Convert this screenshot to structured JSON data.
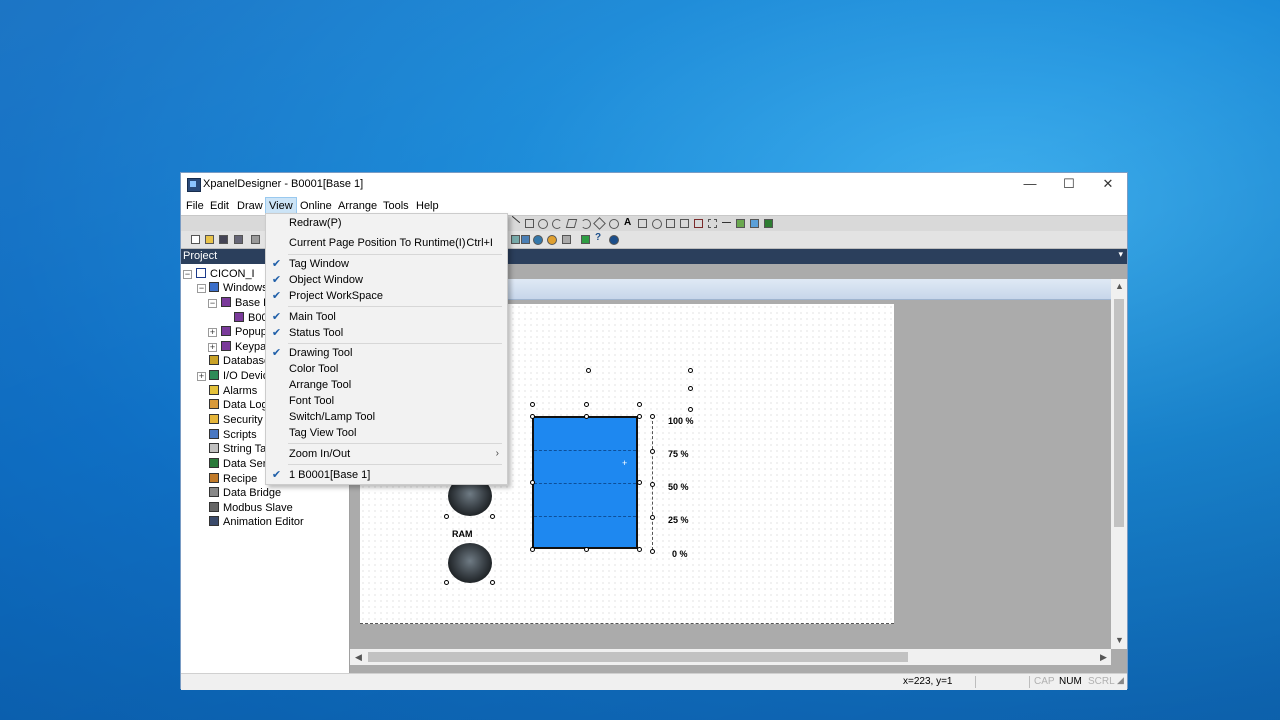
{
  "window": {
    "title": "XpanelDesigner - B0001[Base 1]",
    "minimize_glyph": "—",
    "maximize_glyph": "☐",
    "close_glyph": "✕"
  },
  "menubar": [
    "File",
    "Edit",
    "Draw",
    "View",
    "Online",
    "Arrange",
    "Tools",
    "Help"
  ],
  "project_panel": {
    "title": "Project",
    "tree": [
      {
        "label": "CICON_I",
        "icon": "project-icon"
      },
      {
        "label": "Windows",
        "icon": "monitor-icon"
      },
      {
        "label": "Base P",
        "icon": "window-icon"
      },
      {
        "label": "B00",
        "icon": "window-icon"
      },
      {
        "label": "Popup",
        "icon": "window-icon"
      },
      {
        "label": "Keypa",
        "icon": "window-icon"
      },
      {
        "label": "Database",
        "icon": "database-icon"
      },
      {
        "label": "I/O Devic",
        "icon": "io-device-icon"
      },
      {
        "label": "Alarms",
        "icon": "bell-icon"
      },
      {
        "label": "Data Log",
        "icon": "log-icon"
      },
      {
        "label": "Security",
        "icon": "key-icon"
      },
      {
        "label": "Scripts",
        "icon": "script-icon"
      },
      {
        "label": "String Tab",
        "icon": "string-table-icon"
      },
      {
        "label": "Data Serv",
        "icon": "data-server-icon"
      },
      {
        "label": "Recipe",
        "icon": "recipe-icon"
      },
      {
        "label": "Data Bridge",
        "icon": "bridge-icon"
      },
      {
        "label": "Modbus Slave",
        "icon": "modbus-icon"
      },
      {
        "label": "Animation Editor",
        "icon": "animation-icon"
      }
    ]
  },
  "view_menu": {
    "items": [
      {
        "label": "Redraw(P)",
        "checked": false
      },
      {
        "label": "Current Page Position To Runtime(I)",
        "shortcut": "Ctrl+I",
        "checked": false
      },
      {
        "label": "Tag Window",
        "checked": true
      },
      {
        "label": "Object Window",
        "checked": true
      },
      {
        "label": "Project WorkSpace",
        "checked": true
      },
      {
        "label": "Main Tool",
        "checked": true
      },
      {
        "label": "Status Tool",
        "checked": true
      },
      {
        "label": "Drawing Tool",
        "checked": true
      },
      {
        "label": "Color Tool",
        "checked": false
      },
      {
        "label": "Arrange Tool",
        "checked": false
      },
      {
        "label": "Font Tool",
        "checked": false
      },
      {
        "label": "Switch/Lamp Tool",
        "checked": false
      },
      {
        "label": "Tag View Tool",
        "checked": false
      },
      {
        "label": "Zoom In/Out",
        "submenu": true,
        "checked": false
      },
      {
        "label": "1 B0001[Base 1]",
        "checked": true
      }
    ],
    "check_glyph": "✔",
    "submenu_glyph": "›"
  },
  "canvas": {
    "scale_labels": [
      "100 %",
      "75 %",
      "50 %",
      "25 %",
      "0 %"
    ],
    "knob_label": "RAM",
    "tank_color": "#1e88f0"
  },
  "statusbar": {
    "coords": "x=223, y=1",
    "cap": "CAP",
    "num": "NUM",
    "scrl": "SCRL"
  },
  "colors": {
    "project_bar": "#2b3f5c",
    "menu_highlight": "#cce4f7"
  }
}
